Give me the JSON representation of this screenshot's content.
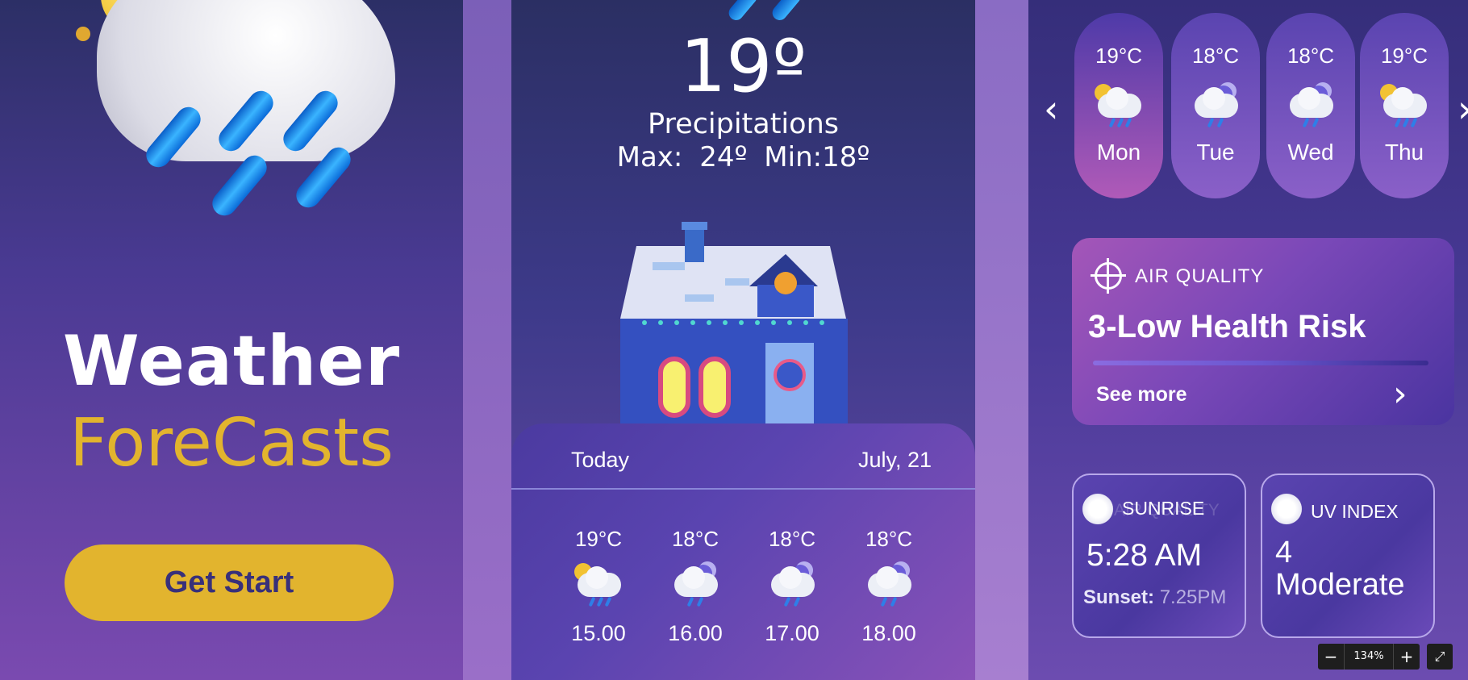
{
  "hero": {
    "title": "Weather",
    "subtitle": "ForeCasts",
    "cta_label": "Get Start"
  },
  "current": {
    "temperature": "19º",
    "condition": "Precipitations",
    "max_min": "Max: 24º   Min:18º"
  },
  "today": {
    "label": "Today",
    "date": "July, 21",
    "hours": [
      {
        "temp": "19°C",
        "time": "15.00",
        "icon": "sun-cloud-rain-icon"
      },
      {
        "temp": "18°C",
        "time": "16.00",
        "icon": "moon-cloud-rain-icon"
      },
      {
        "temp": "18°C",
        "time": "17.00",
        "icon": "moon-cloud-rain-icon"
      },
      {
        "temp": "18°C",
        "time": "18.00",
        "icon": "moon-cloud-rain-icon"
      }
    ]
  },
  "week": {
    "days": [
      {
        "temp": "19°C",
        "day": "Mon",
        "icon": "sun-cloud-rain-icon"
      },
      {
        "temp": "18°C",
        "day": "Tue",
        "icon": "moon-cloud-rain-icon"
      },
      {
        "temp": "18°C",
        "day": "Wed",
        "icon": "moon-cloud-rain-icon"
      },
      {
        "temp": "19°C",
        "day": "Thu",
        "icon": "sun-cloud-rain-icon"
      }
    ]
  },
  "air_quality": {
    "label": "AIR QUALITY",
    "value": "3-Low Health Risk",
    "more": "See more"
  },
  "sunrise": {
    "label": "SUNRISE",
    "ghost": "AIR QUALITY",
    "value": "5:28 AM",
    "sunset_label": "Sunset:",
    "sunset_value": "7.25PM"
  },
  "uv": {
    "label": "UV INDEX",
    "value_line1": "4",
    "value_line2": "Moderate"
  },
  "zoom": {
    "minus": "−",
    "level": "134%",
    "plus": "+",
    "fullscreen": "⤢"
  },
  "colors": {
    "accent": "#e2b42e",
    "background": "#2b2f63",
    "button_text": "#38307a"
  }
}
